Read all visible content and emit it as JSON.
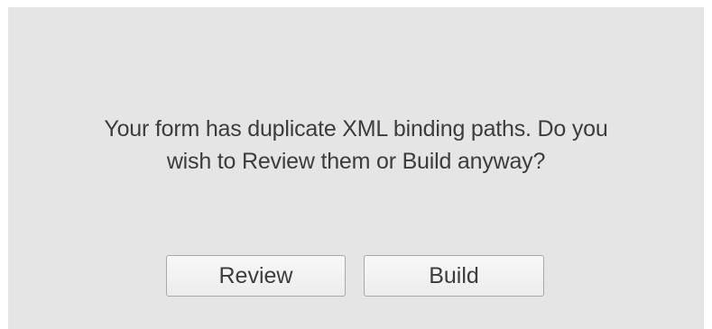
{
  "dialog": {
    "message_line1": "Your form has duplicate XML binding paths. Do you",
    "message_line2": "wish to Review them or Build anyway?",
    "review_label": "Review",
    "build_label": "Build"
  },
  "colors": {
    "dialog_background": "#e5e5e5",
    "text": "#3c3c3c",
    "button_border": "#a9a9a9"
  }
}
